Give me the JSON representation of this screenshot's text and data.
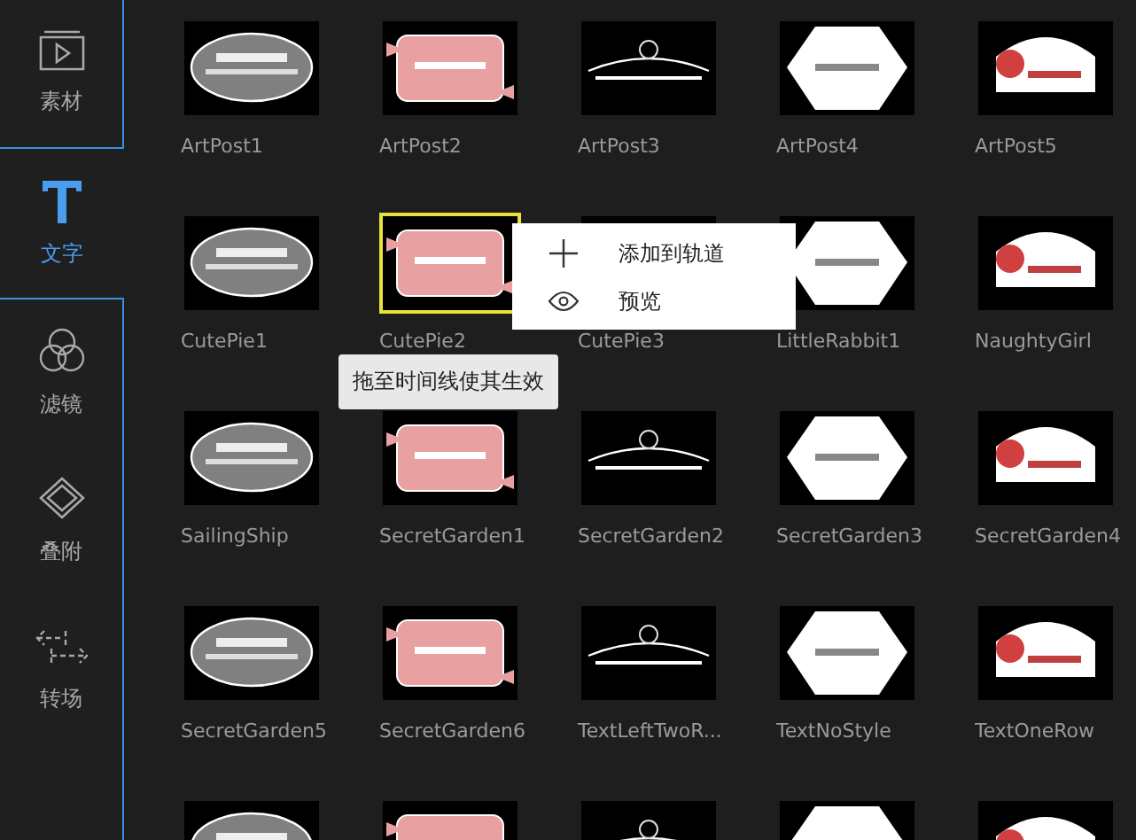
{
  "sidebar": {
    "items": [
      {
        "label": "素材",
        "kind": "media",
        "selected": false
      },
      {
        "label": "文字",
        "kind": "text",
        "selected": true
      },
      {
        "label": "滤镜",
        "kind": "filter",
        "selected": false
      },
      {
        "label": "叠附",
        "kind": "overlay",
        "selected": false
      },
      {
        "label": "转场",
        "kind": "transition",
        "selected": false
      }
    ]
  },
  "templates": [
    {
      "kind": "template",
      "label": "ArtPost1",
      "selected": false
    },
    {
      "kind": "template",
      "label": "ArtPost2",
      "selected": false
    },
    {
      "kind": "template",
      "label": "ArtPost3",
      "selected": false
    },
    {
      "kind": "template",
      "label": "ArtPost4",
      "selected": false
    },
    {
      "kind": "template",
      "label": "ArtPost5",
      "selected": false
    },
    {
      "kind": "template",
      "label": "CutePie1",
      "selected": false
    },
    {
      "kind": "template",
      "label": "CutePie2",
      "selected": true
    },
    {
      "kind": "template",
      "label": "CutePie3",
      "selected": false
    },
    {
      "kind": "template",
      "label": "LittleRabbit1",
      "selected": false
    },
    {
      "kind": "template",
      "label": "NaughtyGirl",
      "selected": false
    },
    {
      "kind": "template",
      "label": "SailingShip",
      "selected": false
    },
    {
      "kind": "template",
      "label": "SecretGarden1",
      "selected": false
    },
    {
      "kind": "template",
      "label": "SecretGarden2",
      "selected": false
    },
    {
      "kind": "template",
      "label": "SecretGarden3",
      "selected": false
    },
    {
      "kind": "template",
      "label": "SecretGarden4",
      "selected": false
    },
    {
      "kind": "template",
      "label": "SecretGarden5",
      "selected": false
    },
    {
      "kind": "template",
      "label": "SecretGarden6",
      "selected": false
    },
    {
      "kind": "template",
      "label": "TextLeftTwoR...",
      "selected": false
    },
    {
      "kind": "template",
      "label": "TextNoStyle",
      "selected": false
    },
    {
      "kind": "template",
      "label": "TextOneRow",
      "selected": false
    },
    {
      "kind": "picture",
      "selected": false
    },
    {
      "kind": "picture",
      "selected": false
    },
    {
      "kind": "picture",
      "selected": false
    },
    {
      "kind": "picture",
      "selected": false
    },
    {
      "kind": "picture",
      "selected": false
    }
  ],
  "context_menu": {
    "items": [
      {
        "label": "添加到轨道",
        "kind": "add"
      },
      {
        "label": "预览",
        "kind": "preview"
      }
    ]
  },
  "tooltip": "拖至时间线使其生效"
}
